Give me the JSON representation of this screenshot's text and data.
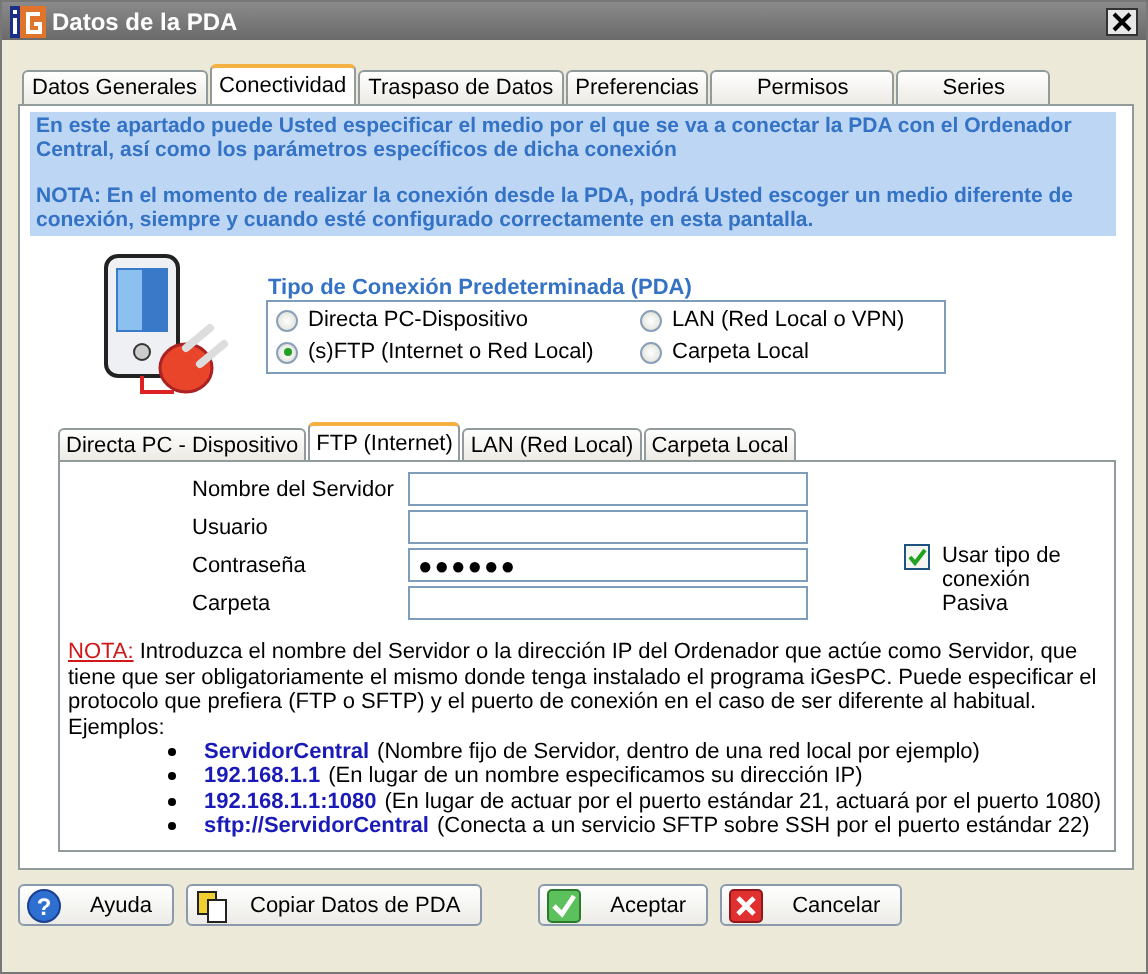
{
  "window": {
    "title": "Datos de la PDA"
  },
  "tabs": [
    {
      "label": "Datos Generales",
      "selected": false
    },
    {
      "label": "Conectividad",
      "selected": true
    },
    {
      "label": "Traspaso de Datos",
      "selected": false
    },
    {
      "label": "Preferencias",
      "selected": false
    },
    {
      "label": "Permisos",
      "selected": false
    },
    {
      "label": "Series",
      "selected": false
    }
  ],
  "info": [
    "En este apartado puede Usted especificar el medio por el que se va a conectar la PDA con el Ordenador Central, así como los parámetros específicos de dicha conexión",
    "NOTA: En el momento de realizar la conexión desde la PDA, podrá Usted escoger un medio diferente de conexión, siempre y cuando esté configurado correctamente en esta pantalla."
  ],
  "connection_type": {
    "title": "Tipo de Conexión Predeterminada (PDA)",
    "options": [
      {
        "label": "Directa PC-Dispositivo",
        "selected": false
      },
      {
        "label": "LAN (Red Local o VPN)",
        "selected": false
      },
      {
        "label": "(s)FTP (Internet o Red Local)",
        "selected": true
      },
      {
        "label": "Carpeta Local",
        "selected": false
      }
    ]
  },
  "sub_tabs": [
    {
      "label": "Directa PC - Dispositivo",
      "selected": false
    },
    {
      "label": "FTP (Internet)",
      "selected": true
    },
    {
      "label": "LAN (Red Local)",
      "selected": false
    },
    {
      "label": "Carpeta Local",
      "selected": false
    }
  ],
  "fields": [
    {
      "label": "Nombre del Servidor"
    },
    {
      "label": "Usuario"
    },
    {
      "label": "Contraseña",
      "value": "●●●●●●"
    },
    {
      "label": "Carpeta"
    }
  ],
  "passive": {
    "label": "Usar tipo de conexión Pasiva",
    "checked": true
  },
  "note": {
    "lead": "NOTA:",
    "text": "Introduzca el nombre del Servidor o la dirección IP del Ordenador que actúe como Servidor, que tiene que ser obligatoriamente el mismo donde tenga instalado el programa iGesPC. Puede especificar el protocolo que prefiera (FTP o SFTP) y el puerto de conexión en el caso de ser diferente al habitual.",
    "examples_label": "Ejemplos:"
  },
  "examples": [
    {
      "value": "ServidorCentral",
      "description": "(Nombre fijo de Servidor, dentro de una red local por ejemplo)"
    },
    {
      "value": "192.168.1.1",
      "description": "(En lugar de un nombre especificamos su dirección IP)"
    },
    {
      "value": "192.168.1.1:1080",
      "description": "(En lugar de actuar por el puerto estándar 21, actuará por el puerto 1080)"
    },
    {
      "value": "sftp://ServidorCentral",
      "description": "(Conecta a un servicio SFTP sobre SSH por el puerto estándar 22)"
    }
  ],
  "buttons": [
    {
      "label": "Ayuda",
      "kind": "help",
      "icon": "?"
    },
    {
      "label": "Copiar Datos de PDA",
      "kind": "copy"
    },
    {
      "label": "Aceptar",
      "kind": "ok"
    },
    {
      "label": "Cancelar",
      "kind": "cancel"
    }
  ]
}
